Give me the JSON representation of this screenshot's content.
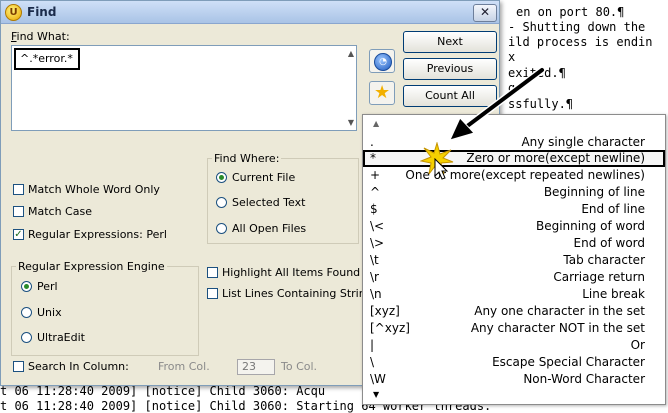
{
  "editor": {
    "lines": [
      "en on port 80.¶",
      "- Shutting down the",
      "ild process is endin",
      "x",
      "exited.¶",
      "g",
      "ssfully.¶",
      "t 06 11:28:40 2009] [notice] Child 3060: Acqu",
      "t 06 11:28:40 2009] [notice] Child 3060: Starting 64 worker threads."
    ]
  },
  "dialog": {
    "title": "Find",
    "close_glyph": "✕",
    "find_what_label": "Find What:",
    "find_what_value": "^.*error.*",
    "buttons": {
      "next": "Next",
      "previous": "Previous",
      "count_all": "Count All"
    },
    "find_where": {
      "legend": "Find Where:",
      "options": [
        "Current File",
        "Selected Text",
        "All Open Files"
      ],
      "selected": "Current File"
    },
    "checks": {
      "whole_word": {
        "label": "Match Whole Word Only",
        "checked": false
      },
      "match_case": {
        "label": "Match Case",
        "checked": false
      },
      "regex": {
        "label": "Regular Expressions: Perl",
        "checked": true
      },
      "highlight_all": {
        "label": "Highlight All Items Found",
        "checked": false
      },
      "list_lines": {
        "label": "List Lines Containing String",
        "checked": false
      },
      "search_in_column": {
        "label": "Search In Column:",
        "checked": false
      }
    },
    "engine": {
      "legend": "Regular Expression Engine",
      "options": [
        "Perl",
        "Unix",
        "UltraEdit"
      ],
      "selected": "Perl"
    },
    "column": {
      "from_label": "From Col.",
      "from_value": "23",
      "to_label": "To Col."
    }
  },
  "regex_popup": {
    "items": [
      {
        "symbol": ".",
        "desc": "Any single character"
      },
      {
        "symbol": "*",
        "desc": "Zero or more(except newline)",
        "selected": true
      },
      {
        "symbol": "+",
        "desc": "One or more(except repeated newlines)"
      },
      {
        "symbol": "^",
        "desc": "Beginning of line"
      },
      {
        "symbol": "$",
        "desc": "End of line"
      },
      {
        "symbol": "\\<",
        "desc": "Beginning of word"
      },
      {
        "symbol": "\\>",
        "desc": "End of word"
      },
      {
        "symbol": "\\t",
        "desc": "Tab character"
      },
      {
        "symbol": "\\r",
        "desc": "Carriage return"
      },
      {
        "symbol": "\\n",
        "desc": "Line break"
      },
      {
        "symbol": "[xyz]",
        "desc": "Any one character in the set"
      },
      {
        "symbol": "[^xyz]",
        "desc": "Any character NOT in the set"
      },
      {
        "symbol": "|",
        "desc": "Or"
      },
      {
        "symbol": "\\",
        "desc": "Escape Special Character"
      },
      {
        "symbol": "\\W",
        "desc": "Non-Word Character"
      }
    ]
  },
  "colors": {
    "highlight_burst": "#f5d000",
    "arrow": "#000000"
  }
}
